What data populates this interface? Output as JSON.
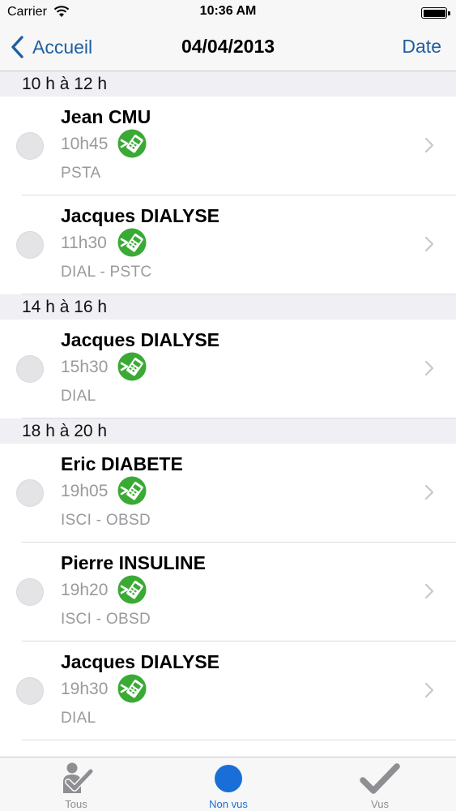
{
  "status_bar": {
    "carrier": "Carrier",
    "time": "10:36 AM"
  },
  "nav": {
    "back_label": "Accueil",
    "title": "04/04/2013",
    "right_label": "Date"
  },
  "sections": [
    {
      "header": "10 h à 12 h",
      "rows": [
        {
          "name": "Jean CMU",
          "time": "10h45",
          "codes": "PSTA"
        },
        {
          "name": "Jacques DIALYSE",
          "time": "11h30",
          "codes": "DIAL - PSTC"
        }
      ]
    },
    {
      "header": "14 h à 16 h",
      "rows": [
        {
          "name": "Jacques DIALYSE",
          "time": "15h30",
          "codes": "DIAL"
        }
      ]
    },
    {
      "header": "18 h à 20 h",
      "rows": [
        {
          "name": "Eric DIABETE",
          "time": "19h05",
          "codes": "ISCI - OBSD"
        },
        {
          "name": "Pierre INSULINE",
          "time": "19h20",
          "codes": "ISCI - OBSD"
        },
        {
          "name": "Jacques DIALYSE",
          "time": "19h30",
          "codes": "DIAL"
        }
      ]
    }
  ],
  "tabs": [
    {
      "label": "Tous",
      "icon": "check-person-icon",
      "active": false
    },
    {
      "label": "Non vus",
      "icon": "blue-dot-icon",
      "active": true
    },
    {
      "label": "Vus",
      "icon": "checkmark-icon",
      "active": false
    }
  ],
  "colors": {
    "accent": "#1f5fa0",
    "card_icon": "#3aaa35",
    "tab_active": "#1a6ed8",
    "section_bg": "#efeff4"
  }
}
